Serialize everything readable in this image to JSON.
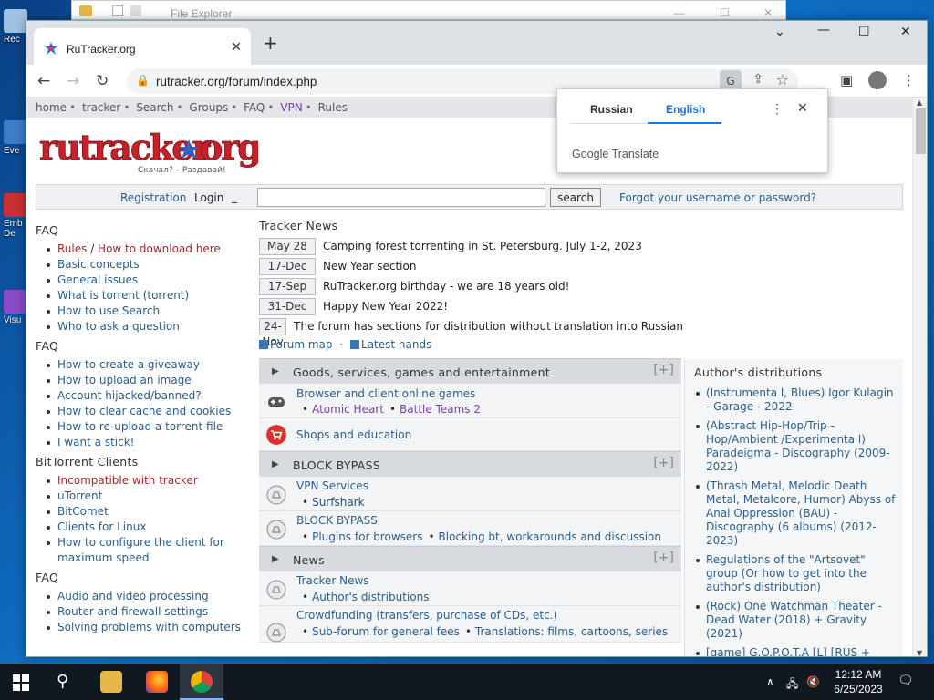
{
  "desktop": {
    "icons": [
      {
        "label": "Rec"
      },
      {
        "label": "Eve"
      },
      {
        "label": "Emb"
      },
      {
        "label": "De"
      },
      {
        "label": "Visu"
      }
    ]
  },
  "explorer": {
    "title": "File Explorer"
  },
  "browser": {
    "tab_title": "RuTracker.org",
    "url": "rutracker.org/forum/index.php"
  },
  "translate_popup": {
    "source_lang": "Russian",
    "target_lang": "English",
    "brand": "Google Translate"
  },
  "site": {
    "topnav": {
      "home": "home",
      "tracker": "tracker",
      "search": "Search",
      "groups": "Groups",
      "faq": "FAQ",
      "vpn": "VPN",
      "rules": "Rules"
    },
    "logo_tagline": "Скачал? – Раздавай!",
    "login": {
      "registration": "Registration",
      "login": "Login",
      "underscore": "_",
      "search_button": "search",
      "forgot": "Forgot your username or password?"
    },
    "sidebar": {
      "faq1_title": "FAQ",
      "faq1_items": {
        "rules": "Rules",
        "slash": " / ",
        "how_download": "How to download here",
        "basic": "Basic concepts",
        "general": "General issues",
        "torrent": "What is torrent (torrent)",
        "use_search": "How to use Search",
        "ask": "Who to ask a question"
      },
      "faq2_title": "FAQ",
      "faq2_items": {
        "giveaway": "How to create a giveaway",
        "upload_image": "How to upload an image",
        "hijacked": "Account hijacked/banned?",
        "cache": "How to clear cache and cookies",
        "reupload": "How to re-upload a torrent file",
        "stick": "I want a stick!"
      },
      "bt_title": "BitTorrent Clients",
      "bt_items": {
        "incompatible": "Incompatible with tracker",
        "utorrent": "uTorrent",
        "bitcomet": "BitComet",
        "linux": "Clients for Linux",
        "configure": "How to configure the client for maximum speed"
      },
      "faq3_title": "FAQ",
      "faq3_items": {
        "audio_video": "Audio and video processing",
        "router": "Router and firewall settings",
        "solving": "Solving problems with computers"
      }
    },
    "news": {
      "title": "Tracker News",
      "items": [
        {
          "date": "May 28",
          "text": "Camping forest torrenting in St. Petersburg. July 1-2, 2023"
        },
        {
          "date": "17-Dec",
          "text": "New Year section"
        },
        {
          "date": "17-Sep",
          "text": "RuTracker.org birthday - we are 18 years old!"
        },
        {
          "date": "31-Dec",
          "text": "Happy New Year 2022!"
        },
        {
          "date": "24-Nov",
          "text": "The forum has sections for distribution without translation into Russian"
        }
      ],
      "forum_map": "Forum map",
      "dot": "·",
      "latest_hands": "Latest hands"
    },
    "forums": {
      "cat1": "Goods, services, games and entertainment",
      "cat1_f1": "Browser and client online games",
      "cat1_f1_s1": "Atomic Heart",
      "cat1_f1_s2": "Battle Teams 2",
      "cat1_f2": "Shops and education",
      "cat2": "BLOCK BYPASS",
      "cat2_f1": "VPN Services",
      "cat2_f1_s1": "Surfshark",
      "cat2_f2": "BLOCK BYPASS",
      "cat2_f2_s1": "Plugins for browsers",
      "cat2_f2_s2": "Blocking bt, workarounds and discussion",
      "cat3": "News",
      "cat3_f1": "Tracker News",
      "cat3_f1_s1": "Author's distributions",
      "cat3_f2": "Crowdfunding (transfers, purchase of CDs, etc.)",
      "cat3_f2_s1": "Sub-forum for general fees",
      "cat3_f2_s2": "Translations: films, cartoons, series",
      "plus": "[+]"
    },
    "authors": {
      "title": "Author's distributions",
      "items": [
        "(Instrumenta l, Blues) Igor Kulagin - Garage - 2022",
        "(Abstract Hip-Hop/Trip - Hop/Ambient /Experimenta l) Paradeigma - Discography (2009-2022)",
        "(Thrash Metal, Melodic Death Metal, Metalcore, Humor) Abyss of Anal Oppression (BAU) - Discography (6 albums) (2012-2023)",
        "Regulations of the \"Artsovet\" group (Or how to get into the author's distribution)",
        "(Rock) One Watchman Theater - Dead Water (2018) + Gravity (2021)",
        "[game] G.O.P.O.T.A [L] [RUS +"
      ]
    }
  },
  "taskbar": {
    "time": "12:12 AM",
    "date": "6/25/2023"
  },
  "colors": {
    "link": "#2b5d8b",
    "rules_red": "#9b2b2b",
    "vpn_purple": "#6c3da6",
    "translate_blue": "#1a73e8"
  }
}
